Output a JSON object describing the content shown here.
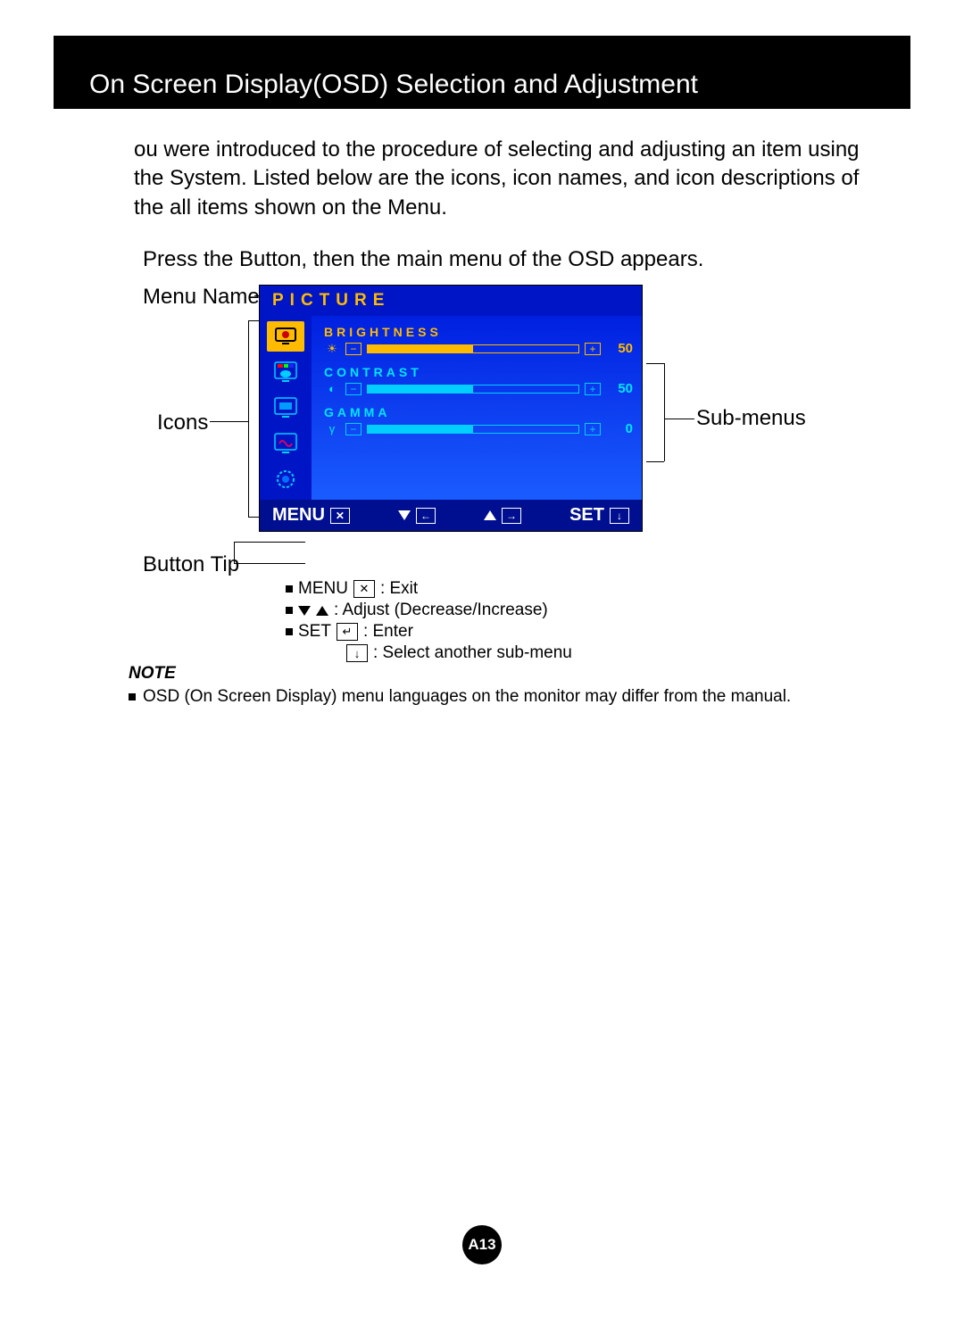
{
  "title": "On Screen Display(OSD) Selection and Adjustment",
  "intro": "ou were introduced to the procedure of selecting and adjusting an item using the System. Listed below are the icons, icon names, and icon descriptions of the all items shown on the Menu.",
  "press_line": "Press the Button, then the main menu of the OSD appears.",
  "labels": {
    "menu_name": "Menu Name",
    "icons": "Icons",
    "sub_menus": "Sub-menus",
    "button_tip": "Button Tip"
  },
  "osd": {
    "title": "PICTURE",
    "items": [
      {
        "label": "BRIGHTNESS",
        "value": "50",
        "active": true,
        "fill": 50
      },
      {
        "label": "CONTRAST",
        "value": "50",
        "active": false,
        "fill": 50
      },
      {
        "label": "GAMMA",
        "value": "0",
        "active": false,
        "fill": 50
      }
    ],
    "footer": {
      "menu": "MENU",
      "set": "SET"
    }
  },
  "tips": {
    "menu_label": "MENU",
    "menu_desc": ": Exit",
    "adjust_desc": ": Adjust (Decrease/Increase)",
    "set_label": "SET",
    "set_desc": ": Enter",
    "select_desc": ": Select another sub-menu"
  },
  "note": {
    "label": "NOTE",
    "text": "OSD (On Screen Display) menu languages on the monitor may differ from the manual."
  },
  "page_number": "A13"
}
